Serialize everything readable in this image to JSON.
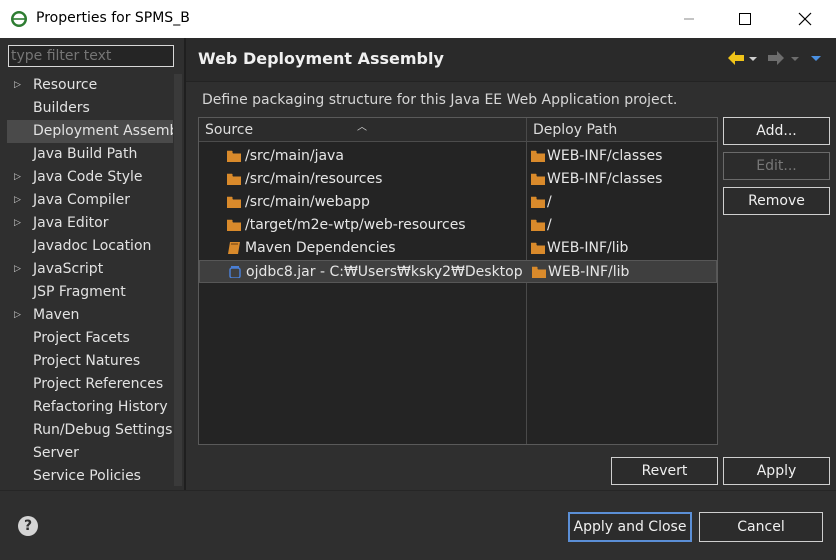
{
  "window": {
    "title": "Properties for SPMS_B",
    "controls": [
      "minimize-icon",
      "maximize-icon",
      "close-icon"
    ]
  },
  "filter": {
    "placeholder": "type filter text"
  },
  "sidebar": {
    "items": [
      {
        "label": "Resource",
        "expandable": true
      },
      {
        "label": "Builders",
        "expandable": false
      },
      {
        "label": "Deployment Assembly",
        "expandable": false,
        "selected": true
      },
      {
        "label": "Java Build Path",
        "expandable": false
      },
      {
        "label": "Java Code Style",
        "expandable": true
      },
      {
        "label": "Java Compiler",
        "expandable": true
      },
      {
        "label": "Java Editor",
        "expandable": true
      },
      {
        "label": "Javadoc Location",
        "expandable": false
      },
      {
        "label": "JavaScript",
        "expandable": true
      },
      {
        "label": "JSP Fragment",
        "expandable": false
      },
      {
        "label": "Maven",
        "expandable": true
      },
      {
        "label": "Project Facets",
        "expandable": false
      },
      {
        "label": "Project Natures",
        "expandable": false
      },
      {
        "label": "Project References",
        "expandable": false
      },
      {
        "label": "Refactoring History",
        "expandable": false
      },
      {
        "label": "Run/Debug Settings",
        "expandable": false
      },
      {
        "label": "Server",
        "expandable": false
      },
      {
        "label": "Service Policies",
        "expandable": false
      }
    ]
  },
  "main": {
    "title": "Web Deployment Assembly",
    "description": "Define packaging structure for this Java EE Web Application project.",
    "table": {
      "headers": {
        "source": "Source",
        "deploy_path": "Deploy Path"
      },
      "rows": [
        {
          "source": "/src/main/java",
          "source_icon": "folder-icon",
          "deploy": "WEB-INF/classes"
        },
        {
          "source": "/src/main/resources",
          "source_icon": "folder-icon",
          "deploy": "WEB-INF/classes"
        },
        {
          "source": "/src/main/webapp",
          "source_icon": "folder-icon",
          "deploy": "/"
        },
        {
          "source": "/target/m2e-wtp/web-resources",
          "source_icon": "folder-icon",
          "deploy": "/"
        },
        {
          "source": "Maven Dependencies",
          "source_icon": "library-icon",
          "deploy": "WEB-INF/lib"
        },
        {
          "source": "ojdbc8.jar - C:₩Users₩ksky2₩Desktop",
          "source_icon": "jar-icon",
          "deploy": "WEB-INF/lib",
          "selected": true
        }
      ]
    },
    "buttons": {
      "add": "Add...",
      "edit": "Edit...",
      "remove": "Remove",
      "revert": "Revert",
      "apply": "Apply"
    }
  },
  "footer": {
    "help_glyph": "?",
    "apply_and_close": "Apply and Close",
    "cancel": "Cancel"
  },
  "colors": {
    "folder": "#d98a2b",
    "jar": "#4a7fd4",
    "nav_back": "#f0c419",
    "accent_border": "#5b8fd6"
  }
}
